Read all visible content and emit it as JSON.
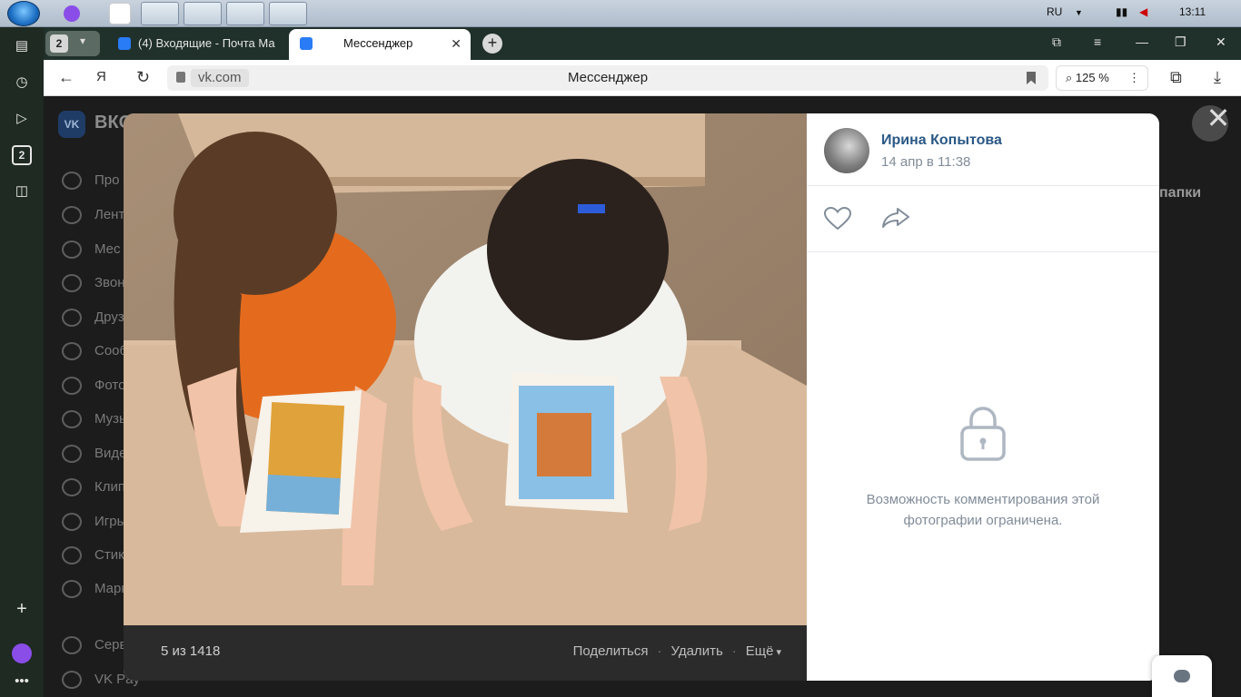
{
  "taskbar": {
    "language": "RU",
    "time": "13:11"
  },
  "browser": {
    "tab_group_count": "2",
    "tabs": [
      {
        "label": "(4) Входящие - Почта Ма",
        "active": false
      },
      {
        "label": "Мессенджер",
        "active": true
      }
    ],
    "new_tab": "+",
    "url_domain": "vk.com",
    "page_title": "Мессенджер",
    "zoom": "125 %",
    "sidebar_badge": "2"
  },
  "vk": {
    "logo_text": "ВКО",
    "menu": [
      {
        "label": "Про"
      },
      {
        "label": "Лент"
      },
      {
        "label": "Мес"
      },
      {
        "label": "Звон"
      },
      {
        "label": "Друз"
      },
      {
        "label": "Сооб"
      },
      {
        "label": "Фото"
      },
      {
        "label": "Музь"
      },
      {
        "label": "Виде"
      },
      {
        "label": "Клип"
      },
      {
        "label": "Игры"
      },
      {
        "label": "Стик"
      },
      {
        "label": "Марк"
      },
      {
        "label": "Серв"
      },
      {
        "label": "VK Pay"
      }
    ],
    "right_text": "папки"
  },
  "viewer": {
    "close": "✕",
    "counter": "5 из 1418",
    "share": "Поделиться",
    "delete": "Удалить",
    "more": "Ещё",
    "author_name": "Ирина Копытова",
    "date": "14 апр в 11:38",
    "restricted_text": "Возможность комментирования этой фотографии ограничена."
  },
  "colors": {
    "vk_link": "#2a5885",
    "muted": "#818c99"
  }
}
